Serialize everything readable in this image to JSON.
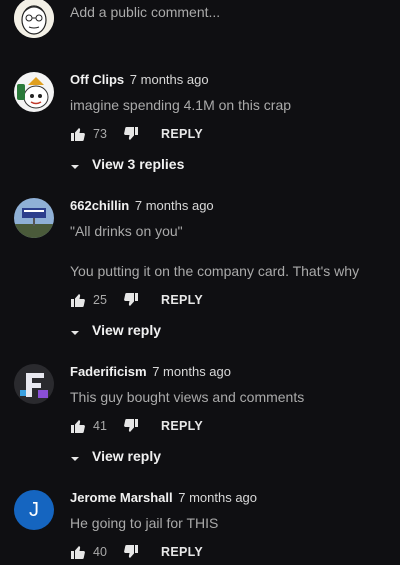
{
  "composer": {
    "placeholder": "Add a public comment..."
  },
  "comments": [
    {
      "author": "Off Clips",
      "time": "7 months ago",
      "text": "imagine spending 4.1M on this crap",
      "text2": "",
      "likes": "73",
      "reply": "REPLY",
      "view": "View 3 replies"
    },
    {
      "author": "662chillin",
      "time": "7 months ago",
      "text": "\"All drinks on you\"",
      "text2": "You putting it on the company card. That's why",
      "likes": "25",
      "reply": "REPLY",
      "view": "View reply"
    },
    {
      "author": "Faderificism",
      "time": "7 months ago",
      "text": "This guy bought views and comments",
      "text2": "",
      "likes": "41",
      "reply": "REPLY",
      "view": "View reply"
    },
    {
      "author": "Jerome Marshall",
      "time": "7 months ago",
      "text": "He going to jail for THIS",
      "text2": "",
      "likes": "40",
      "reply": "REPLY",
      "view": "",
      "avatar_letter": "J"
    }
  ],
  "colors": {
    "background": "#0f0f12",
    "avatar_blue": "#1565c0"
  }
}
